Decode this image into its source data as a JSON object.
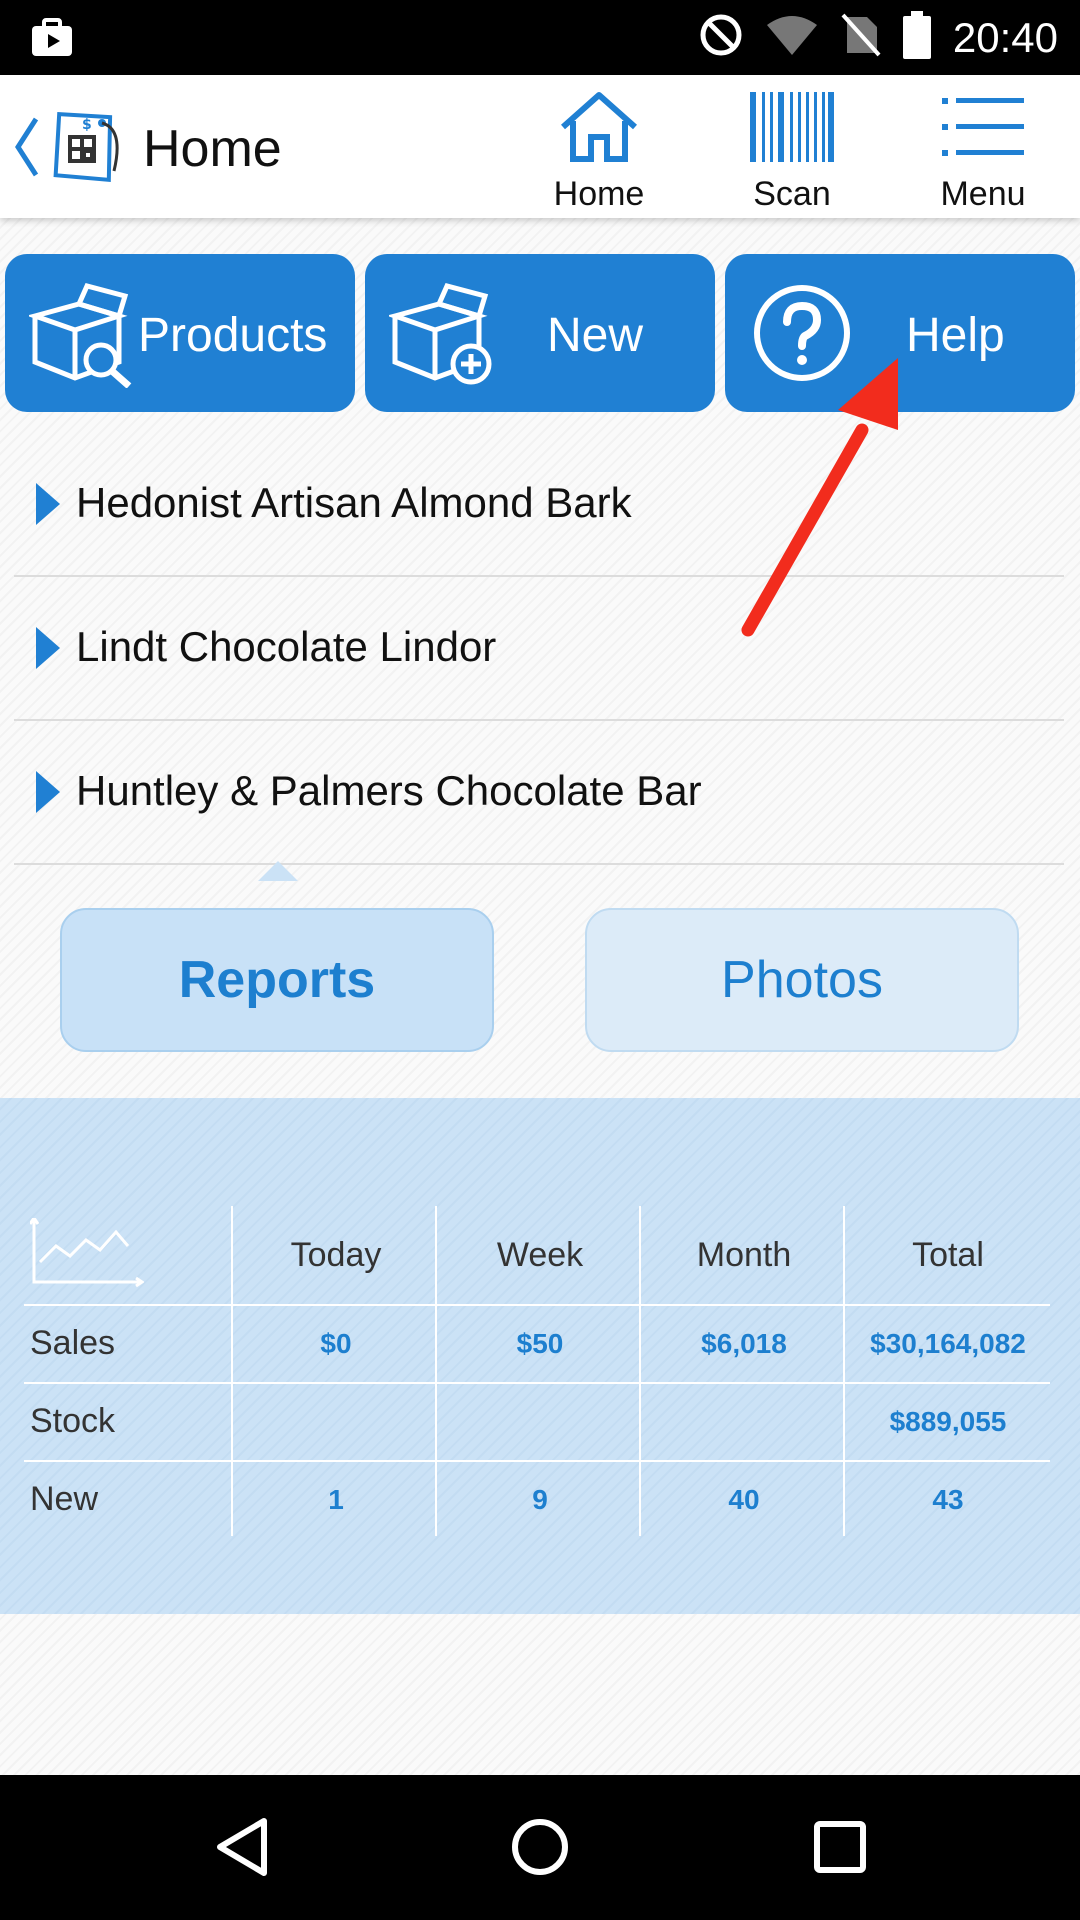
{
  "status_bar": {
    "time": "20:40"
  },
  "app_bar": {
    "title": "Home",
    "nav": [
      {
        "label": "Home",
        "icon": "home-icon"
      },
      {
        "label": "Scan",
        "icon": "barcode-icon"
      },
      {
        "label": "Menu",
        "icon": "menu-icon"
      }
    ]
  },
  "actions": [
    {
      "label": "Products",
      "icon": "box-search-icon"
    },
    {
      "label": "New",
      "icon": "box-add-icon"
    },
    {
      "label": "Help",
      "icon": "help-circle-icon"
    }
  ],
  "products": [
    "Hedonist Artisan Almond Bark",
    "Lindt Chocolate Lindor",
    "Huntley & Palmers Chocolate Bar"
  ],
  "tabs": {
    "active": "Reports",
    "inactive": "Photos"
  },
  "stats": {
    "columns": [
      "Today",
      "Week",
      "Month",
      "Total"
    ],
    "rows": [
      {
        "label": "Sales",
        "values": [
          "$0",
          "$50",
          "$6,018",
          "$30,164,082"
        ]
      },
      {
        "label": "Stock",
        "values": [
          "",
          "",
          "",
          "$889,055"
        ]
      },
      {
        "label": "New",
        "values": [
          "1",
          "9",
          "40",
          "43"
        ]
      }
    ]
  },
  "colors": {
    "primary": "#2080d3",
    "accent_text": "#1d7fcf",
    "annotation": "#f22c1d"
  }
}
